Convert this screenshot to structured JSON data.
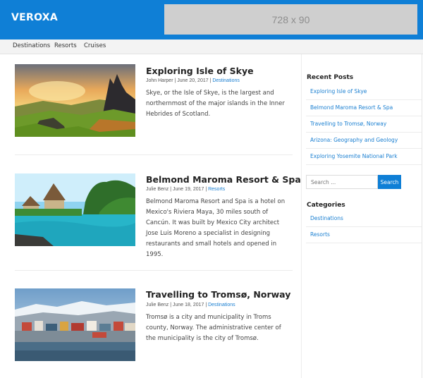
{
  "header": {
    "logo": "VEROXA",
    "ad_label": "728 x 90"
  },
  "nav": {
    "items": [
      {
        "label": "Destinations"
      },
      {
        "label": "Resorts"
      },
      {
        "label": "Cruises"
      }
    ]
  },
  "posts": [
    {
      "title": "Exploring Isle of Skye",
      "author": "John Harper",
      "date": "June 20, 2017",
      "category": "Destinations",
      "excerpt": "Skye, or the Isle of Skye, is the largest and northernmost of the major islands in the Inner Hebrides of Scotland.",
      "image_icon": "mountain-landscape-image"
    },
    {
      "title": "Belmond Maroma Resort & Spa",
      "author": "Julie Benz",
      "date": "June 19, 2017",
      "category": "Resorts",
      "excerpt": "Belmond Maroma Resort and Spa is a hotel on Mexico's Riviera Maya, 30 miles south of Cancún. It was built by Mexico City architect Jose Luis Moreno a specialist in designing restaurants and small hotels and opened in 1995.",
      "image_icon": "resort-pool-image"
    },
    {
      "title": "Travelling to Tromsø, Norway",
      "author": "Julie Benz",
      "date": "June 18, 2017",
      "category": "Destinations",
      "excerpt": "Tromsø is a city and municipality in Troms county, Norway. The administrative center of the municipality is the city of Tromsø.",
      "image_icon": "city-harbor-image"
    }
  ],
  "meta_separator": " | ",
  "sidebar": {
    "recent_posts_title": "Recent Posts",
    "recent_posts": [
      "Exploring Isle of Skye",
      "Belmond Maroma Resort & Spa",
      "Travelling to Tromsø, Norway",
      "Arizona: Geography and Geology",
      "Exploring Yosemite National Park"
    ],
    "search": {
      "placeholder": "Search ...",
      "button_label": "Search"
    },
    "categories_title": "Categories",
    "categories": [
      "Destinations",
      "Resorts"
    ]
  },
  "colors": {
    "brand_blue": "#0f7fd6",
    "link_blue": "#1a7fd1"
  }
}
